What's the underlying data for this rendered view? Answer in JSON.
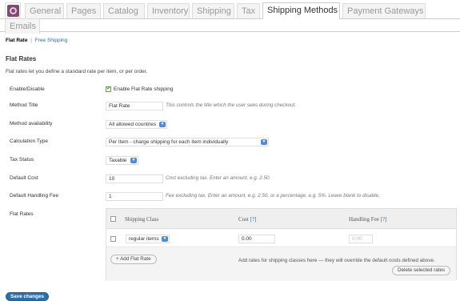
{
  "tabs": [
    {
      "label": "General"
    },
    {
      "label": "Pages"
    },
    {
      "label": "Catalog"
    },
    {
      "label": "Inventory"
    },
    {
      "label": "Shipping"
    },
    {
      "label": "Tax"
    },
    {
      "label": "Shipping Methods"
    },
    {
      "label": "Payment Gateways"
    },
    {
      "label": "Emails"
    }
  ],
  "active_tab": "Shipping Methods",
  "subnav": {
    "current": "Flat Rate",
    "separator": "|",
    "link": "Free Shipping"
  },
  "section": {
    "title": "Flat Rates",
    "description": "Flat rates let you define a standard rate per item, or per order."
  },
  "form": {
    "enable": {
      "label": "Enable/Disable",
      "checkbox_label": "Enable Flat Rate shipping",
      "checked": true
    },
    "method_title": {
      "label": "Method Title",
      "value": "Flat Rate",
      "description": "This controls the title which the user sees during checkout."
    },
    "availability": {
      "label": "Method availability",
      "value": "All allowed countries"
    },
    "calc_type": {
      "label": "Calculation Type",
      "value": "Per Item - charge shipping for each item individually"
    },
    "tax_status": {
      "label": "Tax Status",
      "value": "Taxable"
    },
    "default_cost": {
      "label": "Default Cost",
      "value": "10",
      "description": "Cost excluding tax. Enter an amount, e.g. 2.50."
    },
    "handling_fee": {
      "label": "Default Handling Fee",
      "value": "1",
      "description": "Fee excluding tax. Enter an amount, e.g. 2.50, or a percentage, e.g. 5%. Leave blank to disable."
    },
    "flat_rates": {
      "label": "Flat Rates"
    }
  },
  "rates_table": {
    "col_class": "Shipping Class",
    "col_cost": "Cost",
    "col_fee": "Handling Fee",
    "help": "[?]",
    "row": {
      "class": "regular items",
      "cost": "0.00",
      "fee_placeholder": "0.00"
    },
    "add_button": "+ Add Flat Rate",
    "note": "Add rates for shipping classes here — they will override the default costs defined above.",
    "delete_button": "Delete selected rates"
  },
  "save_button": "Save changes",
  "colors": {
    "accent": "#21759b",
    "save": "#2e6fa7",
    "logo": "#7e4a6f",
    "select_chevron": "#4f8bd6"
  },
  "icons": {
    "logo": "woocommerce-logo-icon",
    "dropdown": "chevron-down-icon"
  }
}
